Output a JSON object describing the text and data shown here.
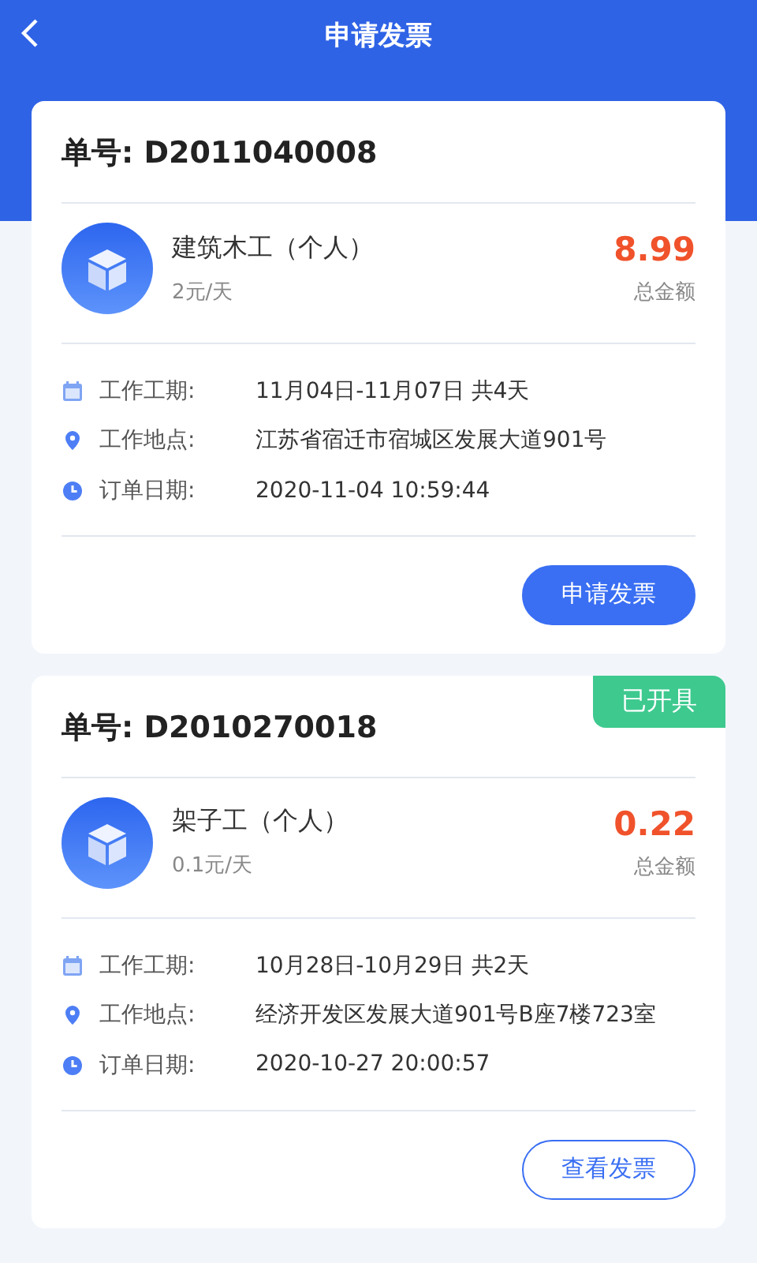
{
  "header": {
    "title": "申请发票"
  },
  "orders": [
    {
      "number_label": "单号: D2011040008",
      "product": {
        "name": "建筑木工（个人）",
        "rate": "2元/天"
      },
      "amount": "8.99",
      "amount_label": "总金额",
      "details": [
        {
          "kind": "calendar",
          "label": "工作工期:",
          "value": "11月04日-11月07日 共4天"
        },
        {
          "kind": "location",
          "label": "工作地点:",
          "value": "江苏省宿迁市宿城区发展大道901号"
        },
        {
          "kind": "clock",
          "label": "订单日期:",
          "value": "2020-11-04 10:59:44"
        }
      ],
      "action": {
        "kind": "primary",
        "label": "申请发票"
      }
    },
    {
      "number_label": "单号: D2010270018",
      "badge": "已开具",
      "product": {
        "name": "架子工（个人）",
        "rate": "0.1元/天"
      },
      "amount": "0.22",
      "amount_label": "总金额",
      "details": [
        {
          "kind": "calendar",
          "label": "工作工期:",
          "value": "10月28日-10月29日 共2天"
        },
        {
          "kind": "location",
          "label": "工作地点:",
          "value": "经济开发区发展大道901号B座7楼723室"
        },
        {
          "kind": "clock",
          "label": "订单日期:",
          "value": "2020-10-27 20:00:57"
        }
      ],
      "action": {
        "kind": "outline",
        "label": "查看发票"
      }
    }
  ]
}
